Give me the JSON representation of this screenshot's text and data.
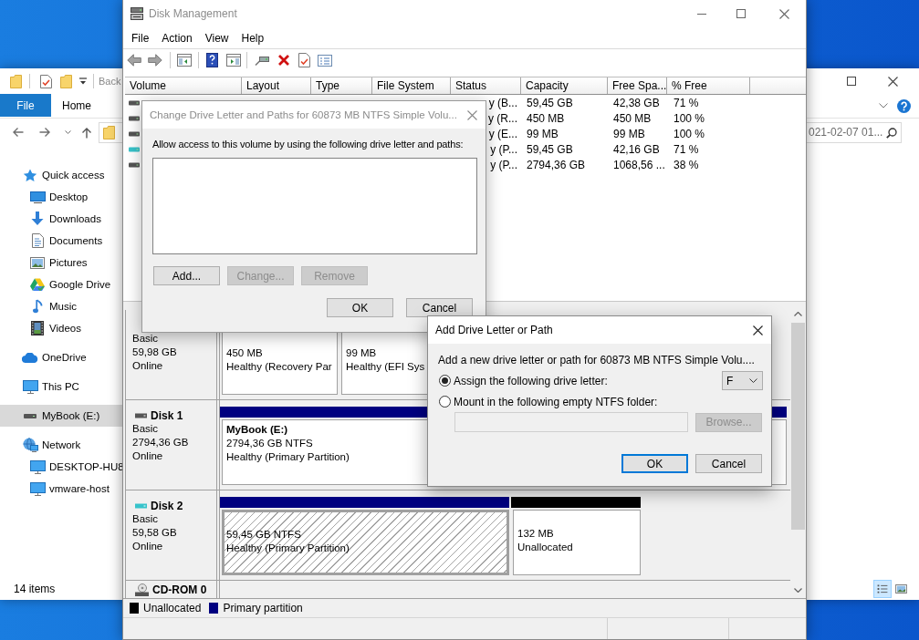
{
  "explorer": {
    "title": "Back",
    "ribbon_tabs": [
      {
        "label": "File",
        "selected": true
      },
      {
        "label": "Home",
        "selected": false
      }
    ],
    "search": {
      "placeholder": "021-02-07 01..."
    },
    "nav": [
      {
        "label": "Quick access",
        "selected": false,
        "children": [
          {
            "label": "Desktop",
            "selected": false
          },
          {
            "label": "Downloads",
            "selected": false
          },
          {
            "label": "Documents",
            "selected": false
          },
          {
            "label": "Pictures",
            "selected": false
          },
          {
            "label": "Google Drive",
            "selected": false
          },
          {
            "label": "Music",
            "selected": false
          },
          {
            "label": "Videos",
            "selected": false
          }
        ]
      },
      {
        "label": "OneDrive",
        "selected": false
      },
      {
        "label": "This PC",
        "selected": false
      },
      {
        "label": "MyBook (E:)",
        "selected": true
      },
      {
        "label": "Network",
        "selected": false,
        "children": [
          {
            "label": "DESKTOP-HU8",
            "selected": false
          },
          {
            "label": "vmware-host",
            "selected": false
          }
        ]
      }
    ],
    "status_bar": "14 items",
    "view_buttons": [
      {
        "selected": true
      },
      {
        "selected": false
      }
    ]
  },
  "disk_management": {
    "title": "Disk Management",
    "active": false,
    "menu": [
      "File",
      "Action",
      "View",
      "Help"
    ],
    "volume_table": {
      "columns": [
        "Volume",
        "Layout",
        "Type",
        "File System",
        "Status",
        "Capacity",
        "Free Spa...",
        "% Free"
      ],
      "rows": [
        {
          "color": "#555555",
          "status": "y (B...",
          "capacity": "59,45 GB",
          "free_space": "42,38 GB",
          "percent_free": "71 %"
        },
        {
          "color": "#555555",
          "status": "y (R...",
          "capacity": "450 MB",
          "free_space": "450 MB",
          "percent_free": "100 %"
        },
        {
          "color": "#555555",
          "status": "y (E...",
          "capacity": "99 MB",
          "free_space": "99 MB",
          "percent_free": "100 %"
        },
        {
          "color": "#37c3cb",
          "status": "y (P...",
          "capacity": "59,45 GB",
          "free_space": "42,16 GB",
          "percent_free": "71 %"
        },
        {
          "color": "#555555",
          "status": "y (P...",
          "capacity": "2794,36 GB",
          "free_space": "1068,56 ...",
          "percent_free": "38 %"
        }
      ]
    },
    "disks": [
      {
        "kind": "disk",
        "type": "Basic",
        "size": "59,98 GB",
        "status": "Online",
        "partitions": [
          {
            "size": "450 MB",
            "status": "Healthy (Recovery Par",
            "selected": false
          },
          {
            "size": "99 MB",
            "status": "Healthy (EFI Sys",
            "selected": false
          }
        ]
      },
      {
        "kind": "disk",
        "name": "Disk 1",
        "color": "#555555",
        "type": "Basic",
        "size": "2794,36 GB",
        "status": "Online",
        "partitions": [
          {
            "kind": "primary",
            "label": "MyBook (E:)",
            "size": "2794,36 GB NTFS",
            "status": "Healthy (Primary Partition)",
            "selected": false
          }
        ]
      },
      {
        "kind": "disk",
        "name": "Disk 2",
        "color": "#37c3cb",
        "type": "Basic",
        "size": "59,58 GB",
        "status": "Online",
        "partitions": [
          {
            "kind": "primary",
            "size": "59,45 GB NTFS",
            "status": "Healthy (Primary Partition)",
            "selected": true
          },
          {
            "kind": "unallocated",
            "size": "132 MB",
            "status": "Unallocated",
            "selected": false
          }
        ]
      },
      {
        "kind": "cdrom",
        "name": "CD-ROM 0"
      }
    ],
    "legend": [
      {
        "label": "Unallocated",
        "color": "#000000"
      },
      {
        "label": "Primary partition",
        "color": "#000080"
      }
    ]
  },
  "change_dialog": {
    "title": "Change Drive Letter and Paths for 60873 MB NTFS Simple Volu...",
    "active": false,
    "prompt": "Allow access to this volume by using the following drive letter and paths:",
    "actions": [
      {
        "label": "Add...",
        "disabled": false
      },
      {
        "label": "Change...",
        "disabled": true
      },
      {
        "label": "Remove",
        "disabled": true
      }
    ],
    "buttons": [
      {
        "label": "OK"
      },
      {
        "label": "Cancel"
      }
    ]
  },
  "add_dialog": {
    "title": "Add Drive Letter or Path",
    "active": true,
    "prompt": "Add a new drive letter or path for 60873 MB NTFS Simple Volu....",
    "options": [
      {
        "label": "Assign the following drive letter:",
        "selected": true
      },
      {
        "label": "Mount in the following empty NTFS folder:",
        "selected": false
      }
    ],
    "drive_letter": {
      "value": "F"
    },
    "folder_path": {
      "disabled": true
    },
    "browse": {
      "label": "Browse...",
      "disabled": true
    },
    "buttons": [
      {
        "label": "OK",
        "default": true
      },
      {
        "label": "Cancel",
        "default": false
      }
    ]
  }
}
